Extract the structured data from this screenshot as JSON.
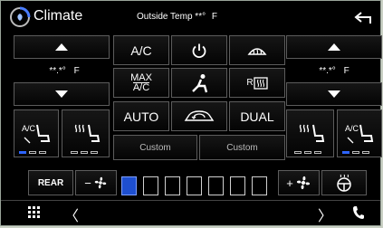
{
  "header": {
    "title": "Climate",
    "outside_temp_label": "Outside Temp",
    "outside_temp_value": "**°",
    "outside_temp_unit": "F"
  },
  "left_zone": {
    "temp_value": "**.*°",
    "temp_unit": "F"
  },
  "right_zone": {
    "temp_value": "**.*°",
    "temp_unit": "F"
  },
  "controls": {
    "ac_label": "A/C",
    "max_ac_line1": "MAX",
    "max_ac_line2": "A/C",
    "auto_label": "AUTO",
    "dual_label": "DUAL",
    "custom_left_label": "Custom",
    "custom_right_label": "Custom",
    "rear_label": "REAR",
    "rear_defrost_label": "R"
  },
  "seat": {
    "ac_label": "A/C"
  },
  "fan": {
    "speed_level": 1,
    "speed_max": 7,
    "minus": "−",
    "plus": "+"
  },
  "nav": {
    "prev": "〈",
    "next": "〉"
  },
  "colors": {
    "accent": "#2d64ff",
    "background": "#000000"
  }
}
